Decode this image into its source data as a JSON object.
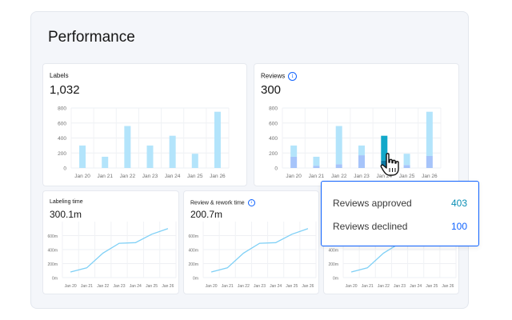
{
  "title": "Performance",
  "colors": {
    "bar_light": "#b3e4fb",
    "bar_dark": "#a6c4fa",
    "bar_highlight": "#12a8c9",
    "bar_highlight_dark": "#0b78a3",
    "line": "#7fd0f6",
    "approved": "#0a8fb5",
    "declined": "#0f62fe",
    "border": "#0f62fe"
  },
  "cards": {
    "labels": {
      "label": "Labels",
      "value": "1,032",
      "chart_data": {
        "type": "bar",
        "categories": [
          "Jan 20",
          "Jan 21",
          "Jan 22",
          "Jan 23",
          "Jan 24",
          "Jan 25",
          "Jan 26"
        ],
        "values": [
          300,
          150,
          560,
          300,
          430,
          190,
          750
        ],
        "ylim": [
          0,
          800
        ],
        "yticks": [
          "0",
          "200",
          "400",
          "600",
          "800"
        ]
      }
    },
    "reviews": {
      "label": "Reviews",
      "value": "300",
      "info_icon": "info-icon",
      "chart_data": {
        "type": "bar",
        "categories": [
          "Jan 20",
          "Jan 21",
          "Jan 22",
          "Jan 23",
          "Jan 24",
          "Jan 25",
          "Jan 26"
        ],
        "series": [
          {
            "values": [
              150,
              30,
              50,
              170,
              100,
              40,
              160
            ]
          },
          {
            "values": [
              150,
              120,
              510,
              130,
              330,
              150,
              590
            ]
          }
        ],
        "ylim": [
          0,
          800
        ],
        "yticks": [
          "0",
          "200",
          "400",
          "600",
          "800"
        ],
        "highlight_index": 4
      }
    },
    "labeling_time": {
      "label": "Labeling time",
      "value": "300.1m",
      "chart_data": {
        "type": "line",
        "categories": [
          "Jan 20",
          "Jan 21",
          "Jan 22",
          "Jan 23",
          "Jan 24",
          "Jan 25",
          "Jan 26"
        ],
        "values": [
          80,
          140,
          350,
          490,
          500,
          620,
          700
        ],
        "ylim": [
          0,
          800
        ],
        "yticks": [
          "0m",
          "200m",
          "400m",
          "600m"
        ]
      }
    },
    "review_rework": {
      "label": "Review & rework time",
      "value": "200.7m",
      "info_icon": "info-icon",
      "chart_data": {
        "type": "line",
        "categories": [
          "Jan 20",
          "Jan 21",
          "Jan 22",
          "Jan 23",
          "Jan 24",
          "Jan 25",
          "Jan 26"
        ],
        "values": [
          80,
          140,
          350,
          490,
          500,
          620,
          700
        ],
        "ylim": [
          0,
          800
        ],
        "yticks": [
          "0m",
          "200m",
          "400m",
          "600m"
        ]
      }
    },
    "third": {
      "chart_data": {
        "type": "line",
        "categories": [
          "Jan 20",
          "Jan 21",
          "Jan 22",
          "Jan 23",
          "Jan 24",
          "Jan 25",
          "Jan 26"
        ],
        "values": [
          80,
          140,
          350,
          490,
          500,
          620,
          700
        ],
        "ylim": [
          0,
          800
        ],
        "yticks": [
          "0m",
          "200m",
          "400m",
          "600m"
        ]
      }
    }
  },
  "tooltip": {
    "approved_label": "Reviews approved",
    "approved_value": "403",
    "declined_label": "Reviews declined",
    "declined_value": "100"
  }
}
